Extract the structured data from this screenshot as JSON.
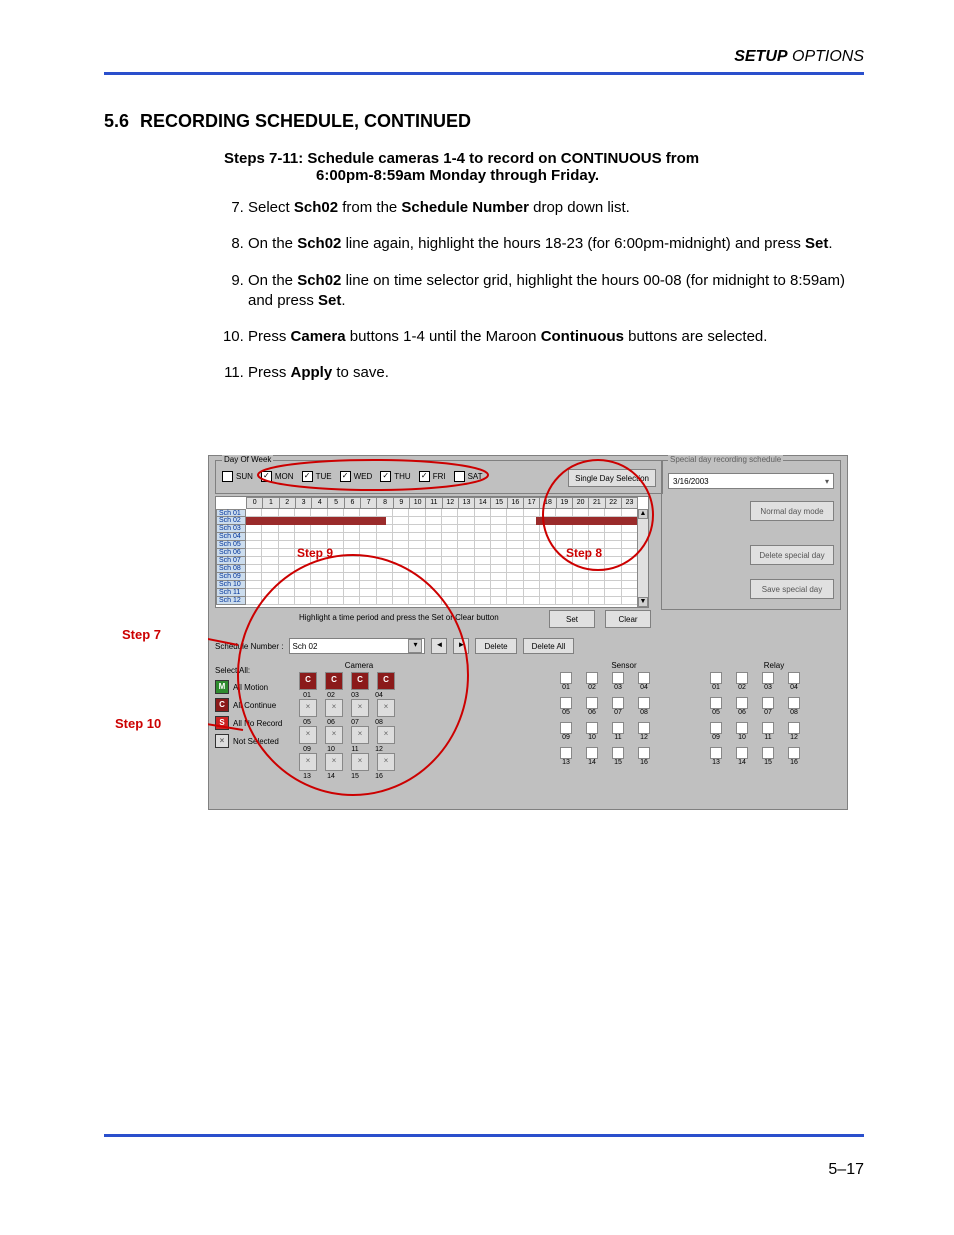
{
  "header": {
    "bold": "SETUP",
    "rest": " OPTIONS"
  },
  "section": {
    "num": "5.6",
    "title": "RECORDING SCHEDULE, CONTINUED"
  },
  "steps_title_line1": "Steps 7-11:   Schedule cameras 1-4 to record on CONTINUOUS from",
  "steps_title_line2": "6:00pm-8:59am Monday through Friday.",
  "steps": {
    "s7a": "Select ",
    "s7b": "Sch02",
    "s7c": " from the ",
    "s7d": "Schedule Number",
    "s7e": " drop down list.",
    "s8a": "On the ",
    "s8b": "Sch02",
    "s8c": " line again, highlight the hours 18-23 (for 6:00pm-midnight) and press ",
    "s8d": "Set",
    "s8e": ".",
    "s9a": "On the ",
    "s9b": "Sch02",
    "s9c": " line on time selector grid, highlight the hours 00-08 (for midnight to 8:59am) and press ",
    "s9d": "Set",
    "s9e": ".",
    "s10a": "Press ",
    "s10b": "Camera",
    "s10c": " buttons 1-4 until the Maroon ",
    "s10d": "Continuous",
    "s10e": " buttons are selected.",
    "s11a": "Press ",
    "s11b": "Apply",
    "s11c": " to save."
  },
  "ui": {
    "dow_legend": "Day Of Week",
    "days": {
      "sun": "SUN",
      "mon": "MON",
      "tue": "TUE",
      "wed": "WED",
      "thu": "THU",
      "fri": "FRI",
      "sat": "SAT"
    },
    "single_day_btn": "Single Day Selection",
    "sp_legend": "Special day recording schedule",
    "sp_date": "3/16/2003",
    "sp_normal": "Normal day mode",
    "sp_delete": "Delete special day",
    "sp_save": "Save special day",
    "hours": [
      "0",
      "1",
      "2",
      "3",
      "4",
      "5",
      "6",
      "7",
      "8",
      "9",
      "10",
      "11",
      "12",
      "13",
      "14",
      "15",
      "16",
      "17",
      "18",
      "19",
      "20",
      "21",
      "22",
      "23"
    ],
    "sch_labels": [
      "Sch 01",
      "Sch 02",
      "Sch 03",
      "Sch 04",
      "Sch 05",
      "Sch 06",
      "Sch 07",
      "Sch 08",
      "Sch 09",
      "Sch 10",
      "Sch 11",
      "Sch 12"
    ],
    "hint": "Highlight a time period and press the Set or Clear button",
    "set": "Set",
    "clear": "Clear",
    "schednum_lbl": "Schedule Number :",
    "schednum_val": "Sch 02",
    "delete": "Delete",
    "deleteall": "Delete All",
    "selall": "Select All:",
    "leg_m": "All Motion",
    "leg_c": "All Continue",
    "leg_s": "All No Record",
    "leg_x": "Not Selected",
    "camera_label": "Camera",
    "sensor_label": "Sensor",
    "relay_label": "Relay",
    "glyph_c": "C",
    "glyph_m": "M",
    "glyph_s": "S",
    "glyph_x": "×",
    "chk_on": "✓",
    "tri": "▾",
    "prev": "◄",
    "next": "►",
    "cam_nums": [
      "01",
      "02",
      "03",
      "04",
      "05",
      "06",
      "07",
      "08",
      "09",
      "10",
      "11",
      "12",
      "13",
      "14",
      "15",
      "16"
    ],
    "sr_nums": [
      "01",
      "02",
      "03",
      "04",
      "05",
      "06",
      "07",
      "08",
      "09",
      "10",
      "11",
      "12",
      "13",
      "14",
      "15",
      "16"
    ]
  },
  "callouts": {
    "step7": "Step 7",
    "step8": "Step 8",
    "step9": "Step 9",
    "step10": "Step 10"
  },
  "pagenum": "5–17"
}
